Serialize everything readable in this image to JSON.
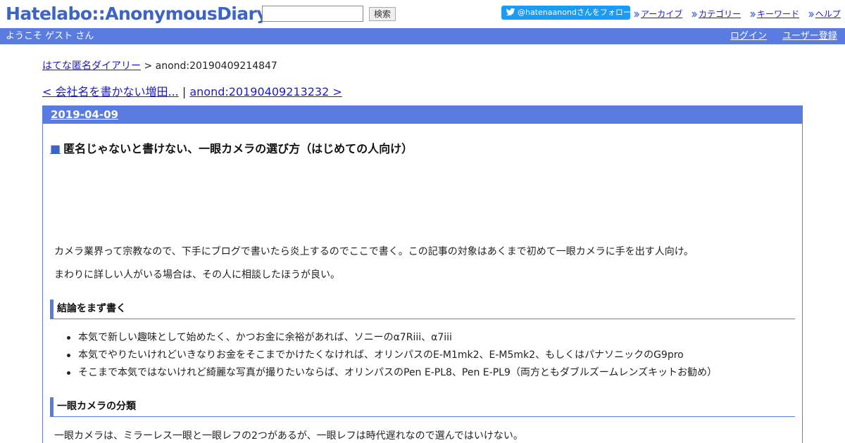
{
  "header": {
    "logo": "Hatelabo::AnonymousDiary",
    "search_placeholder": "",
    "search_button": "検索",
    "twitter_follow": "@hatenaanondさんをフォロー",
    "links": [
      "アーカイブ",
      "カテゴリー",
      "キーワード",
      "ヘルプ"
    ]
  },
  "welcome_bar": {
    "welcome": "ようこそ ゲスト さん",
    "login": "ログイン",
    "register": "ユーザー登録"
  },
  "breadcrumb": {
    "home": "はてな匿名ダイアリー",
    "separator": " > ",
    "current": "anond:20190409214847"
  },
  "pager": {
    "prev": "< 会社名を書かない増田...",
    "separator": " | ",
    "next": "anond:20190409213232 >"
  },
  "article": {
    "date": "2019-04-09",
    "title_marker": "■",
    "title": "匿名じゃないと書けない、一眼カメラの選び方（はじめての人向け）",
    "paragraph_1": "カメラ業界って宗教なので、下手にブログで書いたら炎上するのでここで書く。この記事の対象はあくまで初めて一眼カメラに手を出す人向け。",
    "paragraph_2": "まわりに詳しい人がいる場合は、その人に相談したほうが良い。",
    "section_1": "結論をまず書く",
    "bullets": [
      "本気で新しい趣味として始めたく、かつお金に余裕があれば、ソニーのα7Riii、α7iii",
      "本気でやりたいけれどいきなりお金をそこまでかけたくなければ、オリンパスのE-M1mk2、E-M5mk2、もしくはパナソニックのG9pro",
      "そこまで本気ではないけれど綺麗な写真が撮りたいならば、オリンパスのPen E-PL8、Pen E-PL9（両方ともダブルズームレンズキットお勧め）"
    ],
    "section_2": "一眼カメラの分類",
    "paragraph_3": "一眼カメラは、ミラーレス一眼と一眼レフの2つがあるが、一眼レフは時代遅れなので選んではいけない。"
  },
  "colors": {
    "accent": "#5a7be0",
    "logo": "#3c64c8",
    "link": "#1a1acc",
    "twitter": "#1d9bf0"
  }
}
